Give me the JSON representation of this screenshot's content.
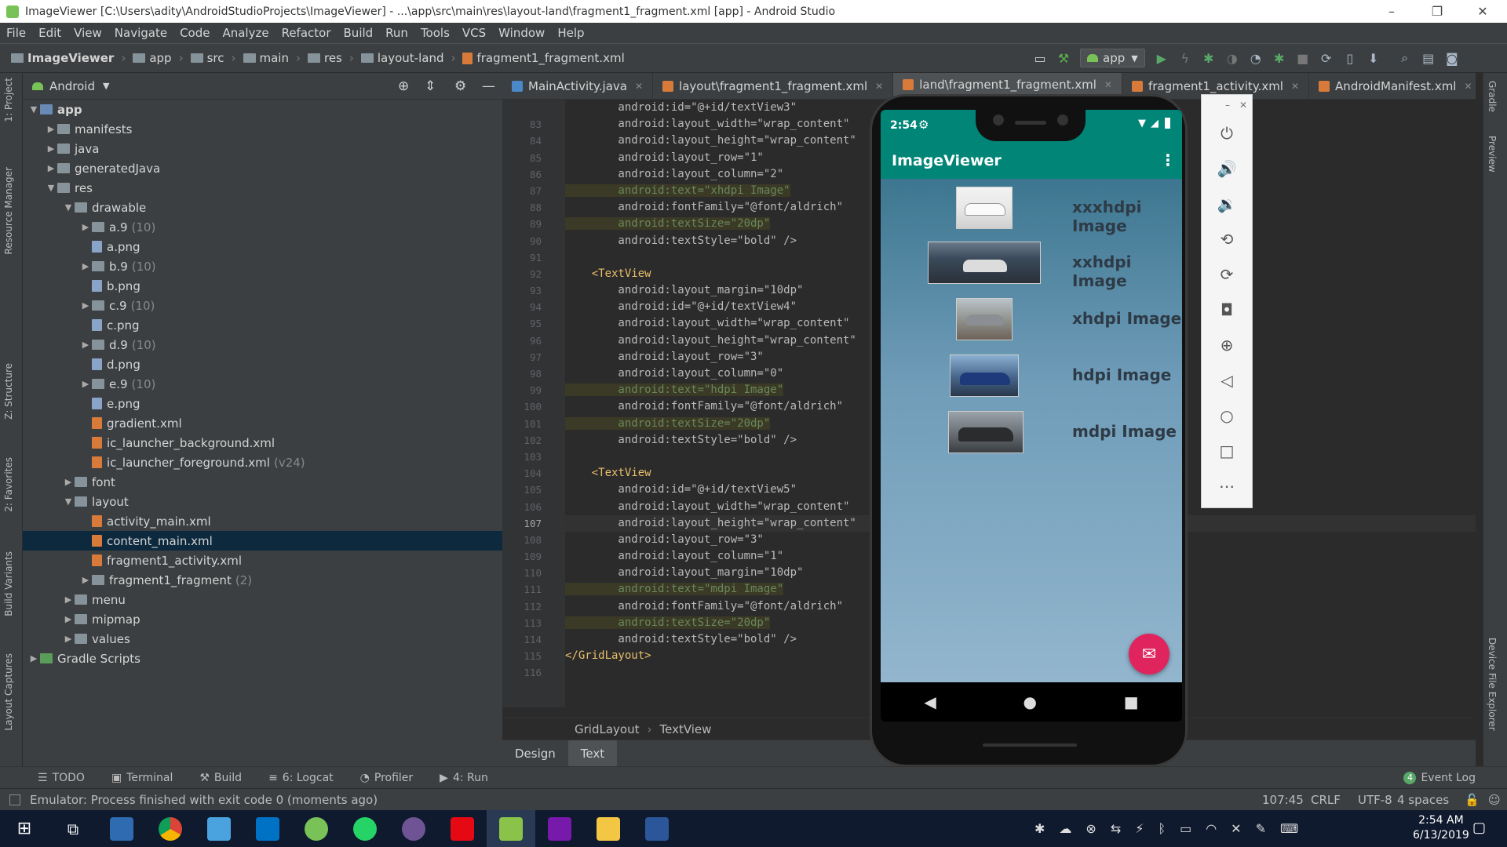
{
  "window": {
    "title": "ImageViewer [C:\\Users\\adity\\AndroidStudioProjects\\ImageViewer] - ...\\app\\src\\main\\res\\layout-land\\fragment1_fragment.xml [app] - Android Studio",
    "minimize": "–",
    "maximize": "❐",
    "close": "✕"
  },
  "menu": [
    "File",
    "Edit",
    "View",
    "Navigate",
    "Code",
    "Analyze",
    "Refactor",
    "Build",
    "Run",
    "Tools",
    "VCS",
    "Window",
    "Help"
  ],
  "breadcrumb": [
    "ImageViewer",
    "app",
    "src",
    "main",
    "res",
    "layout-land",
    "fragment1_fragment.xml"
  ],
  "run_config": "app",
  "project_panel": {
    "view": "Android",
    "tree": [
      {
        "label": "app",
        "depth": 0,
        "kind": "module",
        "open": true,
        "bold": true
      },
      {
        "label": "manifests",
        "depth": 1,
        "kind": "folder",
        "open": false
      },
      {
        "label": "java",
        "depth": 1,
        "kind": "folder",
        "open": false
      },
      {
        "label": "generatedJava",
        "depth": 1,
        "kind": "folder",
        "open": false
      },
      {
        "label": "res",
        "depth": 1,
        "kind": "folder",
        "open": true
      },
      {
        "label": "drawable",
        "depth": 2,
        "kind": "folder",
        "open": true
      },
      {
        "label": "a.9",
        "count": "(10)",
        "depth": 3,
        "kind": "folder",
        "open": false
      },
      {
        "label": "a.png",
        "depth": 3,
        "kind": "png"
      },
      {
        "label": "b.9",
        "count": "(10)",
        "depth": 3,
        "kind": "folder",
        "open": false
      },
      {
        "label": "b.png",
        "depth": 3,
        "kind": "png"
      },
      {
        "label": "c.9",
        "count": "(10)",
        "depth": 3,
        "kind": "folder",
        "open": false
      },
      {
        "label": "c.png",
        "depth": 3,
        "kind": "png"
      },
      {
        "label": "d.9",
        "count": "(10)",
        "depth": 3,
        "kind": "folder",
        "open": false
      },
      {
        "label": "d.png",
        "depth": 3,
        "kind": "png"
      },
      {
        "label": "e.9",
        "count": "(10)",
        "depth": 3,
        "kind": "folder",
        "open": false
      },
      {
        "label": "e.png",
        "depth": 3,
        "kind": "png"
      },
      {
        "label": "gradient.xml",
        "depth": 3,
        "kind": "xml"
      },
      {
        "label": "ic_launcher_background.xml",
        "depth": 3,
        "kind": "xml"
      },
      {
        "label": "ic_launcher_foreground.xml",
        "count": "(v24)",
        "depth": 3,
        "kind": "xml"
      },
      {
        "label": "font",
        "depth": 2,
        "kind": "folder",
        "open": false
      },
      {
        "label": "layout",
        "depth": 2,
        "kind": "folder",
        "open": true
      },
      {
        "label": "activity_main.xml",
        "depth": 3,
        "kind": "xml"
      },
      {
        "label": "content_main.xml",
        "depth": 3,
        "kind": "xml",
        "selected": true
      },
      {
        "label": "fragment1_activity.xml",
        "depth": 3,
        "kind": "xml"
      },
      {
        "label": "fragment1_fragment",
        "count": "(2)",
        "depth": 3,
        "kind": "folder",
        "open": false
      },
      {
        "label": "menu",
        "depth": 2,
        "kind": "folder",
        "open": false
      },
      {
        "label": "mipmap",
        "depth": 2,
        "kind": "folder",
        "open": false
      },
      {
        "label": "values",
        "depth": 2,
        "kind": "folder",
        "open": false
      },
      {
        "label": "Gradle Scripts",
        "depth": 0,
        "kind": "gradle",
        "open": false
      }
    ]
  },
  "left_tool_tabs": [
    "1: Project",
    "Resource Manager",
    "Z: Structure",
    "2: Favorites",
    "Build Variants",
    "Layout Captures"
  ],
  "right_tool_tabs": [
    "Gradle",
    "Preview",
    "Device File Explorer"
  ],
  "editor_tabs": [
    {
      "label": "MainActivity.java",
      "color": "#4a88c7"
    },
    {
      "label": "layout\\fragment1_fragment.xml",
      "color": "#d87b3a"
    },
    {
      "label": "land\\fragment1_fragment.xml",
      "color": "#d87b3a",
      "active": true
    },
    {
      "label": "fragment1_activity.xml",
      "color": "#d87b3a"
    },
    {
      "label": "AndroidManifest.xml",
      "color": "#d87b3a"
    }
  ],
  "editor": {
    "cursor_line": 107,
    "lines": [
      {
        "n": "",
        "t": "        android:id=\"@+id/textView3\""
      },
      {
        "n": "83",
        "t": "        android:layout_width=\"wrap_content\""
      },
      {
        "n": "84",
        "t": "        android:layout_height=\"wrap_content\""
      },
      {
        "n": "85",
        "t": "        android:layout_row=\"1\""
      },
      {
        "n": "86",
        "t": "        android:layout_column=\"2\""
      },
      {
        "n": "87",
        "t": "        android:text=\"xhdpi Image\"",
        "hl": true
      },
      {
        "n": "88",
        "t": "        android:fontFamily=\"@font/aldrich\""
      },
      {
        "n": "89",
        "t": "        android:textSize=\"20dp\"",
        "hl": true
      },
      {
        "n": "90",
        "t": "        android:textStyle=\"bold\" />"
      },
      {
        "n": "91",
        "t": ""
      },
      {
        "n": "92",
        "t": "    <TextView",
        "tag": true
      },
      {
        "n": "93",
        "t": "        android:layout_margin=\"10dp\""
      },
      {
        "n": "94",
        "t": "        android:id=\"@+id/textView4\""
      },
      {
        "n": "95",
        "t": "        android:layout_width=\"wrap_content\""
      },
      {
        "n": "96",
        "t": "        android:layout_height=\"wrap_content\""
      },
      {
        "n": "97",
        "t": "        android:layout_row=\"3\""
      },
      {
        "n": "98",
        "t": "        android:layout_column=\"0\""
      },
      {
        "n": "99",
        "t": "        android:text=\"hdpi Image\"",
        "hl": true
      },
      {
        "n": "100",
        "t": "        android:fontFamily=\"@font/aldrich\""
      },
      {
        "n": "101",
        "t": "        android:textSize=\"20dp\"",
        "hl": true
      },
      {
        "n": "102",
        "t": "        android:textStyle=\"bold\" />"
      },
      {
        "n": "103",
        "t": ""
      },
      {
        "n": "104",
        "t": "    <TextView",
        "tag": true
      },
      {
        "n": "105",
        "t": "        android:id=\"@+id/textView5\""
      },
      {
        "n": "106",
        "t": "        android:layout_width=\"wrap_content\""
      },
      {
        "n": "107",
        "t": "        android:layout_height=\"wrap_content\"",
        "cur": true
      },
      {
        "n": "108",
        "t": "        android:layout_row=\"3\""
      },
      {
        "n": "109",
        "t": "        android:layout_column=\"1\""
      },
      {
        "n": "110",
        "t": "        android:layout_margin=\"10dp\""
      },
      {
        "n": "111",
        "t": "        android:text=\"mdpi Image\"",
        "hl": true
      },
      {
        "n": "112",
        "t": "        android:fontFamily=\"@font/aldrich\""
      },
      {
        "n": "113",
        "t": "        android:textSize=\"20dp\"",
        "hl": true
      },
      {
        "n": "114",
        "t": "        android:textStyle=\"bold\" />"
      },
      {
        "n": "115",
        "t": "</GridLayout>",
        "tag": true
      },
      {
        "n": "116",
        "t": ""
      }
    ],
    "structure_path": [
      "GridLayout",
      "TextView"
    ],
    "mode_tabs": [
      "Design",
      "Text"
    ],
    "active_mode": "Text"
  },
  "bottom_tools": [
    {
      "icon": "☰",
      "label": "TODO"
    },
    {
      "icon": "▣",
      "label": "Terminal"
    },
    {
      "icon": "⚒",
      "label": "Build"
    },
    {
      "icon": "≡",
      "label": "6: Logcat"
    },
    {
      "icon": "◔",
      "label": "Profiler"
    },
    {
      "icon": "▶",
      "label": "4: Run"
    }
  ],
  "event_log": {
    "count": "4",
    "label": "Event Log"
  },
  "status": {
    "message": "Emulator: Process finished with exit code 0 (moments ago)",
    "position": "107:45",
    "line_sep": "CRLF",
    "encoding": "UTF-8",
    "indent": "4 spaces"
  },
  "emulator": {
    "status_time": "2:54",
    "app_title": "ImageViewer",
    "rows": [
      {
        "label": "xxxhdpi Image"
      },
      {
        "label": "xxhdpi Image"
      },
      {
        "label": "xhdpi Image"
      },
      {
        "label": "hdpi Image"
      },
      {
        "label": "mdpi Image"
      }
    ],
    "controls": [
      "power-icon",
      "volume-up-icon",
      "volume-down-icon",
      "rotate-left-icon",
      "rotate-right-icon",
      "camera-icon",
      "zoom-icon",
      "back-icon",
      "home-icon",
      "overview-icon",
      "more-icon"
    ]
  },
  "taskbar": {
    "time": "2:54 AM",
    "date": "6/13/2019"
  },
  "colors": {
    "accent_teal": "#008577",
    "fab": "#e0245e",
    "editor_bg": "#2b2b2b",
    "panel_bg": "#3c3f41"
  }
}
